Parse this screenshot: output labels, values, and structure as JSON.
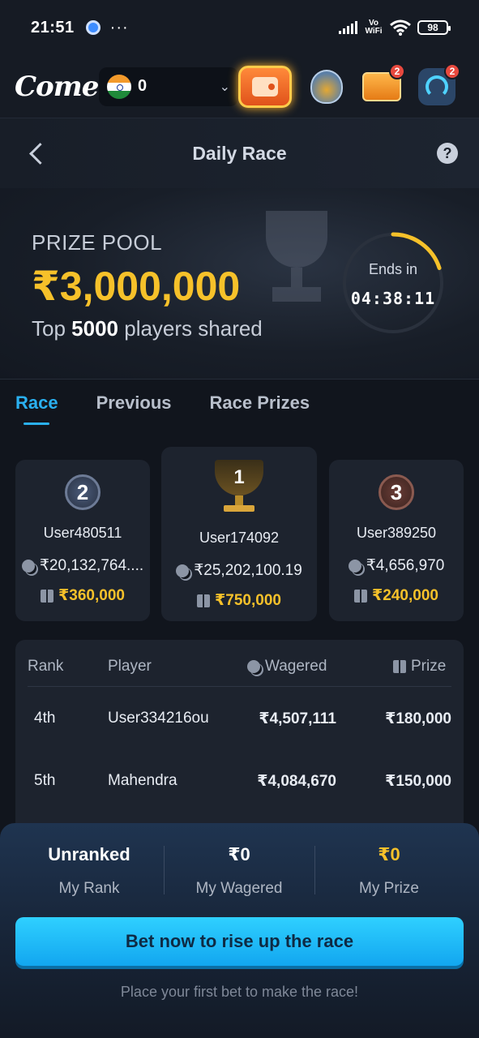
{
  "status_bar": {
    "time": "21:51",
    "more": "···",
    "network_label": "Vo WiFi",
    "battery": "98"
  },
  "header": {
    "logo": "Come",
    "balance": "0",
    "support_badge": "2",
    "gift_badge": "2"
  },
  "page": {
    "title": "Daily Race"
  },
  "hero": {
    "prize_label": "PRIZE POOL",
    "prize_amount": "₹3,000,000",
    "sub_prefix": "Top",
    "sub_count": "5000",
    "sub_suffix": "players shared",
    "ends_label": "Ends in",
    "ends_time": "04:38:11",
    "ends_progress": 0.2
  },
  "tabs": [
    {
      "label": "Race",
      "active": true
    },
    {
      "label": "Previous",
      "active": false
    },
    {
      "label": "Race Prizes",
      "active": false
    }
  ],
  "podium": {
    "second": {
      "rank": "2",
      "name": "User480511",
      "wagered": "₹20,132,764....",
      "prize": "₹360,000"
    },
    "first": {
      "rank": "1",
      "name": "User174092",
      "wagered": "₹25,202,100.19",
      "prize": "₹750,000"
    },
    "third": {
      "rank": "3",
      "name": "User389250",
      "wagered": "₹4,656,970",
      "prize": "₹240,000"
    }
  },
  "table": {
    "headers": {
      "rank": "Rank",
      "player": "Player",
      "wagered": "Wagered",
      "prize": "Prize"
    },
    "rows": [
      {
        "rank": "4th",
        "player": "User334216ou",
        "wagered": "₹4,507,111",
        "prize": "₹180,000"
      },
      {
        "rank": "5th",
        "player": "Mahendra",
        "wagered": "₹4,084,670",
        "prize": "₹150,000"
      }
    ]
  },
  "my_stats": {
    "rank_value": "Unranked",
    "rank_label": "My Rank",
    "wagered_value": "₹0",
    "wagered_label": "My Wagered",
    "prize_value": "₹0",
    "prize_label": "My Prize"
  },
  "cta": {
    "label": "Bet now to rise up the race",
    "hint": "Place your first bet to make the race!"
  },
  "colors": {
    "accent": "#2ab0f0",
    "gold": "#f6c12a",
    "background": "#11151d"
  }
}
